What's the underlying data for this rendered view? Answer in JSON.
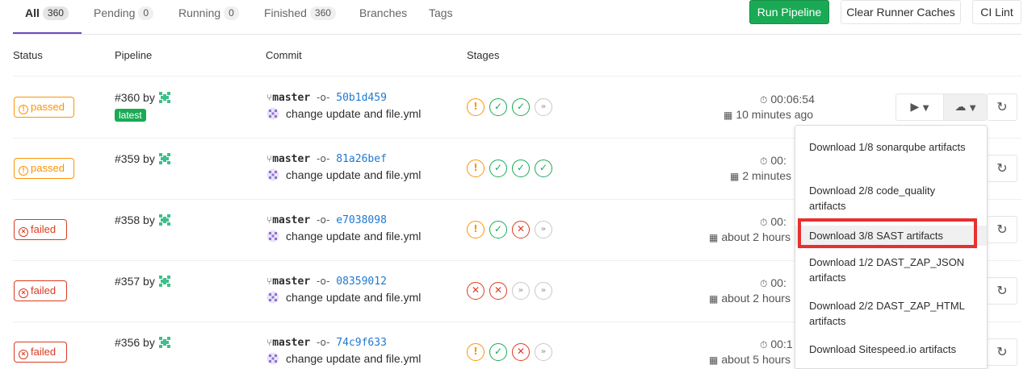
{
  "tabs": [
    {
      "label": "All",
      "count": "360"
    },
    {
      "label": "Pending",
      "count": "0"
    },
    {
      "label": "Running",
      "count": "0"
    },
    {
      "label": "Finished",
      "count": "360"
    },
    {
      "label": "Branches"
    },
    {
      "label": "Tags"
    }
  ],
  "toolbar": {
    "run_pipeline": "Run Pipeline",
    "clear_caches": "Clear Runner Caches",
    "ci_lint": "CI Lint",
    "run_pipeline_color": "#1aaa55"
  },
  "table_headers": {
    "status": "Status",
    "pipeline": "Pipeline",
    "commit": "Commit",
    "stages": "Stages"
  },
  "pipelines": [
    {
      "status": "passed",
      "id": "#360 by",
      "latest": "latest",
      "branch": "master",
      "sha": "50b1d459",
      "message": "change update and file.yml",
      "stages": [
        "warning",
        "success",
        "success",
        "skipped"
      ],
      "duration": "00:06:54",
      "finished": "10 minutes ago"
    },
    {
      "status": "passed",
      "id": "#359 by",
      "branch": "master",
      "sha": "81a26bef",
      "message": "change update and file.yml",
      "stages": [
        "warning",
        "success",
        "success",
        "success"
      ],
      "duration": "00:",
      "finished": "2 minutes"
    },
    {
      "status": "failed",
      "id": "#358 by",
      "branch": "master",
      "sha": "e7038098",
      "message": "change update and file.yml",
      "stages": [
        "warning",
        "success",
        "failed",
        "skipped"
      ],
      "duration": "00:",
      "finished": "about 2 hours"
    },
    {
      "status": "failed",
      "id": "#357 by",
      "branch": "master",
      "sha": "08359012",
      "message": "change update and file.yml",
      "stages": [
        "failed",
        "failed",
        "skipped",
        "skipped"
      ],
      "duration": "00:",
      "finished": "about 2 hours"
    },
    {
      "status": "failed",
      "id": "#356 by",
      "branch": "master",
      "sha": "74c9f633",
      "message": "change update and file.yml",
      "stages": [
        "warning",
        "success",
        "failed",
        "skipped"
      ],
      "duration": "00:1",
      "finished": "about 5 hours"
    }
  ],
  "artifacts_menu": [
    "Download 1/8 sonarqube artifacts",
    "Download 2/8 code_quality artifacts",
    "Download 3/8 SAST artifacts",
    "Download 1/2 DAST_ZAP_JSON artifacts",
    "Download 2/2 DAST_ZAP_HTML artifacts",
    "Download Sitespeed.io artifacts"
  ],
  "icons": {
    "play": "play-icon",
    "caret": "chevron-down-icon",
    "download": "cloud-download-icon",
    "retry": "retry-icon",
    "timer": "stopwatch-icon",
    "calendar": "calendar-icon",
    "branch": "git-branch-icon",
    "commit": "git-commit-icon"
  },
  "highlight_color": "#e8302f"
}
